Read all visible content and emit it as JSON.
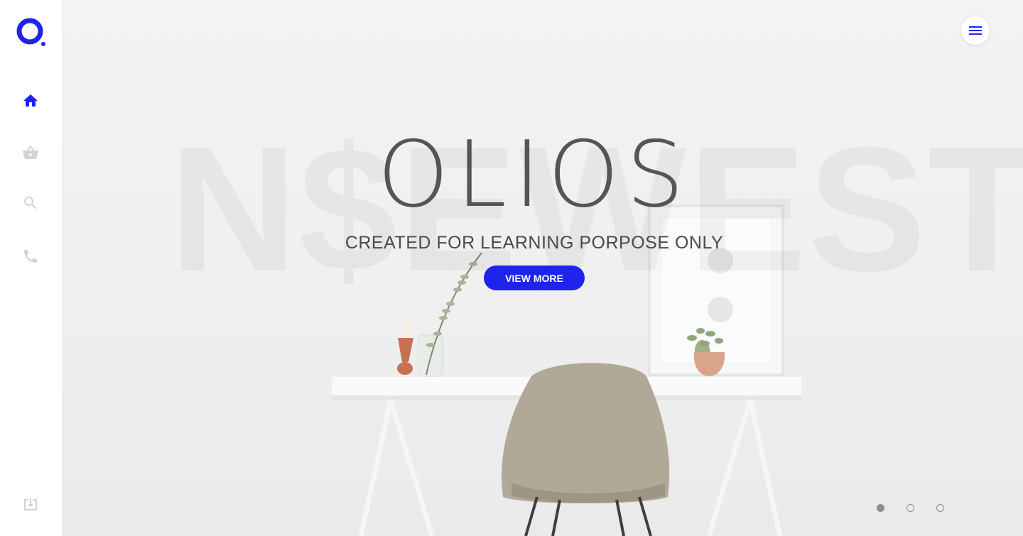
{
  "brand": {
    "logo_icon": "olios-logo-icon",
    "accent_color": "#1f24ec"
  },
  "sidebar": {
    "items": [
      {
        "name": "home",
        "icon": "home-icon",
        "active": true
      },
      {
        "name": "cart",
        "icon": "basket-icon",
        "active": false
      },
      {
        "name": "search",
        "icon": "search-icon",
        "active": false
      },
      {
        "name": "contact",
        "icon": "phone-icon",
        "active": false
      }
    ],
    "footer_icon": "download-icon"
  },
  "hero": {
    "watermark": "N$EWEST",
    "title": "OLIOS",
    "subtitle": "CREATED FOR LEARNING PORPOSE ONLY",
    "cta_label": "VIEW MORE"
  },
  "header": {
    "menu_icon": "hamburger-menu-icon"
  },
  "carousel": {
    "slide_count": 3,
    "active_index": 0
  }
}
